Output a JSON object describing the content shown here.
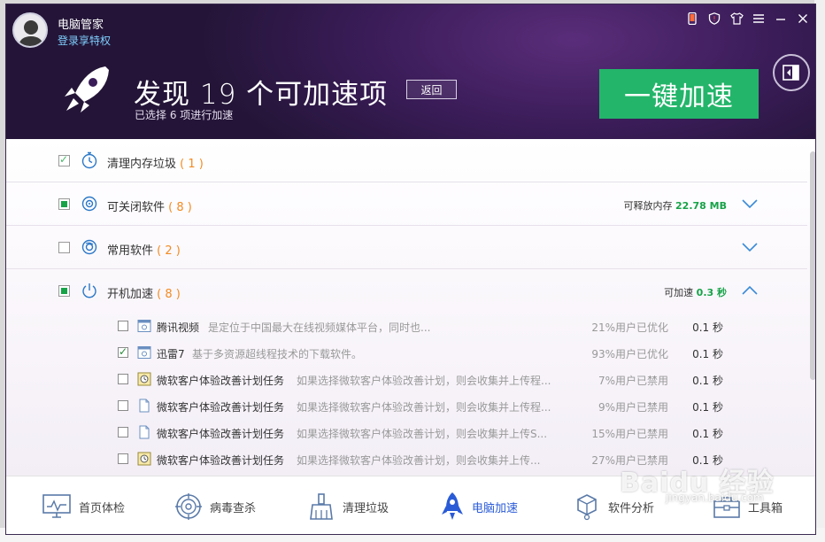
{
  "header": {
    "app_name": "电脑管家",
    "login_link": "登录享特权",
    "headline": "发现 19 个可加速项",
    "subline": "已选择 6 项进行加速",
    "back_label": "返回",
    "boost_label": "一键加速",
    "controls": [
      "phone-icon",
      "shield-icon",
      "shirt-icon",
      "menu-icon",
      "minimize-icon",
      "close-icon"
    ]
  },
  "sections": [
    {
      "title": "清理内存垃圾",
      "count": "( 1 )",
      "right_label": "",
      "right_value": "",
      "checkbox": "check",
      "icon": "stopwatch-icon"
    },
    {
      "title": "可关闭软件",
      "count": "( 8 )",
      "right_label": "可释放内存",
      "right_value": "22.78 MB",
      "checkbox": "filled",
      "icon": "disc-icon"
    },
    {
      "title": "常用软件",
      "count": "( 2 )",
      "right_label": "",
      "right_value": "",
      "checkbox": "empty",
      "icon": "disc-icon"
    },
    {
      "title": "开机加速",
      "count": "( 8 )",
      "right_label": "可加速",
      "right_value": "0.3 秒",
      "checkbox": "filled",
      "icon": "power-icon"
    }
  ],
  "startup_items": [
    {
      "name": "腾讯视频",
      "desc": "是定位于中国最大在线视频媒体平台，同时也...",
      "rate": "21%用户已优化",
      "time": "0.1 秒",
      "checked": false,
      "icon": "app-window-icon"
    },
    {
      "name": "迅雷7",
      "desc": "基于多资源超线程技术的下载软件。",
      "rate": "93%用户已优化",
      "time": "0.1 秒",
      "checked": true,
      "icon": "app-window-icon"
    },
    {
      "name": "微软客户体验改善计划任务",
      "desc": "如果选择微软客户体验改善计划，则会收集并上传程...",
      "rate": "7%用户已禁用",
      "time": "0.1 秒",
      "checked": false,
      "icon": "task-clock-icon"
    },
    {
      "name": "微软客户体验改善计划任务",
      "desc": "如果选择微软客户体验改善计划，则会收集并上传程...",
      "rate": "9%用户已禁用",
      "time": "0.1 秒",
      "checked": false,
      "icon": "document-icon"
    },
    {
      "name": "微软客户体验改善计划任务",
      "desc": "如果选择微软客户体验改善计划，则会收集并上传S...",
      "rate": "15%用户已禁用",
      "time": "0.1 秒",
      "checked": false,
      "icon": "document-icon"
    },
    {
      "name": "微软客户体验改善计划任务",
      "desc": "如果选择微软客户体验改善计划，则会收集并上传...",
      "rate": "27%用户已禁用",
      "time": "0.1 秒",
      "checked": false,
      "icon": "task-clock-icon"
    }
  ],
  "bottom_nav": [
    {
      "label": "首页体检",
      "icon": "monitor-icon",
      "active": false
    },
    {
      "label": "病毒查杀",
      "icon": "target-icon",
      "active": false
    },
    {
      "label": "清理垃圾",
      "icon": "broom-icon",
      "active": false
    },
    {
      "label": "电脑加速",
      "icon": "rocket-icon",
      "active": true
    },
    {
      "label": "软件分析",
      "icon": "cubes-icon",
      "active": false
    },
    {
      "label": "工具箱",
      "icon": "toolbox-icon",
      "active": false
    }
  ],
  "watermark": {
    "text": "Baidu 经验",
    "sub": "jingyan.baidu.com"
  },
  "colors": {
    "accent_green": "#23b56a",
    "highlight_orange": "#f28b23",
    "active_blue": "#2a5bd7",
    "header_purple": "#3a1c58"
  }
}
